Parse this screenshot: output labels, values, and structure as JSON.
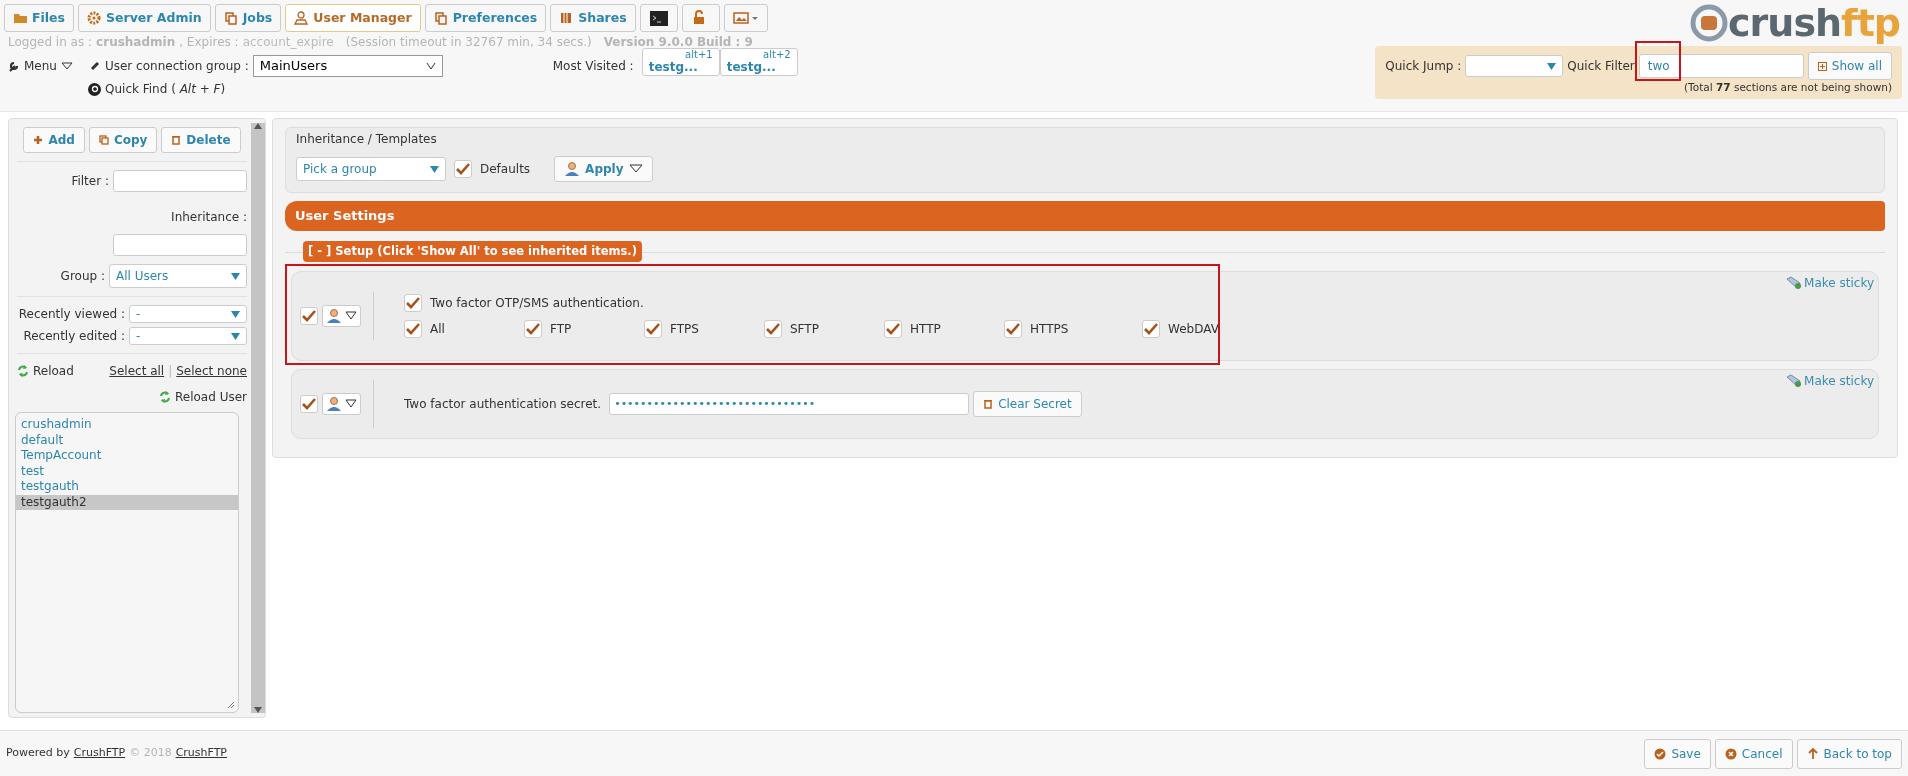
{
  "tabs": [
    {
      "label": "Files",
      "selected": false
    },
    {
      "label": "Server Admin",
      "selected": false
    },
    {
      "label": "Jobs",
      "selected": false
    },
    {
      "label": "User Manager",
      "selected": true
    },
    {
      "label": "Preferences",
      "selected": false
    },
    {
      "label": "Shares",
      "selected": false
    }
  ],
  "session": {
    "logged_in_label": "Logged in as :",
    "user": "crushadmin",
    "expires_label": ", Expires :",
    "expires": "account_expire",
    "timeout": "(Session timeout in 32767 min, 34 secs.)",
    "version": "Version 9.0.0 Build : 9"
  },
  "menu": "Menu",
  "connection_group": {
    "label": "User connection group :",
    "value": "MainUsers"
  },
  "quick_find": "Quick Find ( *Alt* + *F*)",
  "most_visited": {
    "label": "Most Visited :",
    "items": [
      {
        "shortcut": "alt+1",
        "label": "testg..."
      },
      {
        "shortcut": "alt+2",
        "label": "testg..."
      }
    ]
  },
  "logo": {
    "part_1": "crush",
    "part_2": "ftp"
  },
  "quick_bar": {
    "jump_label": "Quick Jump :",
    "filter_label": "Quick Filter",
    "filter_value": "two",
    "filter_highlighted": true,
    "show_all": "Show all",
    "note": "(Total **77** sections are not being shown)"
  },
  "sidebar": {
    "buttons": [
      "Add",
      "Copy",
      "Delete"
    ],
    "filter_label": "Filter :",
    "inheritance_label": "Inheritance :",
    "group_label": "Group :",
    "group_value": "All Users",
    "recently_viewed": {
      "label": "Recently viewed :",
      "value": "-"
    },
    "recently_edited": {
      "label": "Recently edited :",
      "value": "-"
    },
    "reload": "Reload",
    "select_all": "Select all",
    "separator": "|",
    "select_none": "Select none",
    "reload_user": "Reload User",
    "users": [
      {
        "name": "crushadmin",
        "selected": false
      },
      {
        "name": "default",
        "selected": false
      },
      {
        "name": "TempAccount",
        "selected": false
      },
      {
        "name": "test",
        "selected": false
      },
      {
        "name": "testgauth",
        "selected": false
      },
      {
        "name": "testgauth2",
        "selected": true
      }
    ]
  },
  "inheritance": {
    "title": "Inheritance / Templates",
    "group_placeholder": "Pick a group",
    "defaults": {
      "label": "Defaults",
      "checked": true
    },
    "apply": "Apply"
  },
  "settings_title": "User Settings",
  "section": {
    "title": "[ - ] Setup (Click 'Show All' to see inherited items.)",
    "rows": [
      {
        "kind": "options",
        "checked": true,
        "highlighted": true,
        "sticky": "Make sticky",
        "option": {
          "label": "Two factor OTP/SMS authentication.",
          "checked": true
        },
        "protocols": [
          {
            "label": "All",
            "checked": true
          },
          {
            "label": "FTP",
            "checked": true
          },
          {
            "label": "FTPS",
            "checked": true
          },
          {
            "label": "SFTP",
            "checked": true
          },
          {
            "label": "HTTP",
            "checked": true
          },
          {
            "label": "HTTPS",
            "checked": true
          },
          {
            "label": "WebDAV",
            "checked": true
          }
        ]
      },
      {
        "kind": "secret",
        "checked": true,
        "highlighted": false,
        "sticky": "Make sticky",
        "label": "Two factor authentication secret.",
        "value": "•••••••••••••••••••••••••••••••",
        "button": "Clear Secret"
      }
    ]
  },
  "footer": {
    "powered": "Powered by",
    "link": "CrushFTP",
    "copyright": "© 2018",
    "link_2": "CrushFTP",
    "buttons": [
      "Save",
      "Cancel",
      "Back to top"
    ]
  }
}
